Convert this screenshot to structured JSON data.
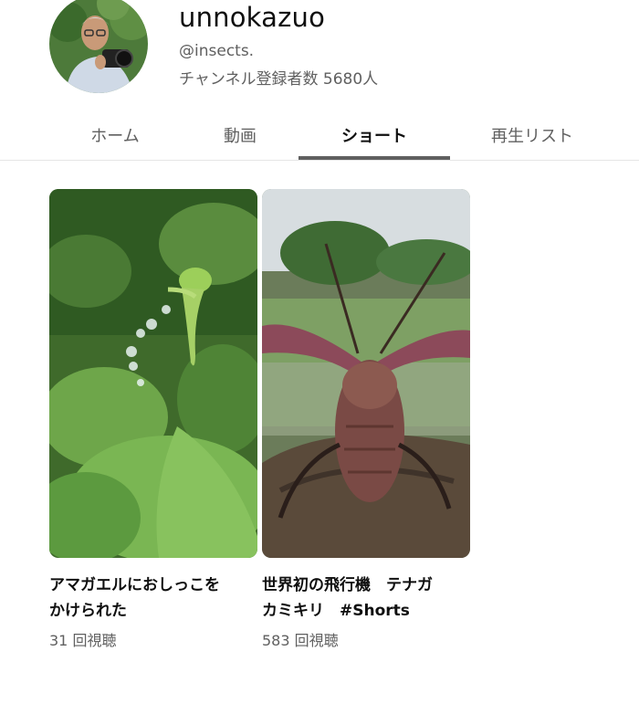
{
  "channel": {
    "name": "unnokazuo",
    "handle": "@insects.",
    "subscribers": "チャンネル登録者数 5680人"
  },
  "tabs": [
    {
      "label": "ホーム",
      "active": false
    },
    {
      "label": "動画",
      "active": false
    },
    {
      "label": "ショート",
      "active": true
    },
    {
      "label": "再生リスト",
      "active": false
    }
  ],
  "shorts": [
    {
      "title": "アマガエルにおしっこをかけられた",
      "views": "31 回視聴",
      "thumbnail": "green-frog-on-leaves"
    },
    {
      "title": "世界初の飛行機　テナガカミキリ　#Shorts",
      "views": "583 回視聴",
      "thumbnail": "harlequin-beetle-flying"
    }
  ],
  "colors": {
    "text_primary": "#0f0f0f",
    "text_secondary": "#606060",
    "tab_indicator": "#606060",
    "divider": "#e5e5e5"
  }
}
